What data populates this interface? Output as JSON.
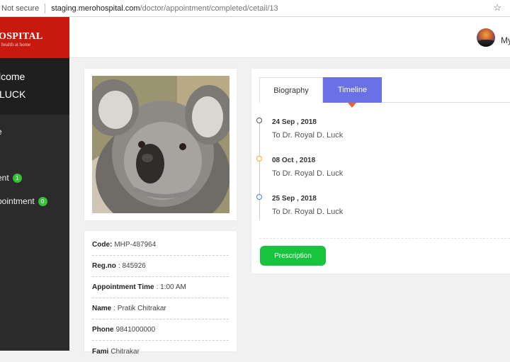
{
  "browser": {
    "security": "Not secure",
    "host": "staging.merohospital.com",
    "path": "/doctor/appointment/completed/cetail/13"
  },
  "sidebar": {
    "logo_title": "OSPITAL",
    "logo_tagline": "health at home",
    "welcome_line1": "lcome",
    "welcome_line2": "LUCK",
    "items": [
      {
        "label": "e"
      },
      {
        "label": "ent",
        "count": "1"
      },
      {
        "label": "pointment",
        "count": "0"
      }
    ]
  },
  "topbar": {
    "user": "My"
  },
  "profile": {
    "rows": [
      {
        "label": "Code:",
        "value": "MHP-487964"
      },
      {
        "label": "Reg.no",
        "value": ": 845926"
      },
      {
        "label": "Appointment Time",
        "value": ": 1:00 AM"
      },
      {
        "label": "Name",
        "value": ": Pratik Chitrakar"
      },
      {
        "label": "Phone",
        "value": "9841000000"
      },
      {
        "label": "Fami",
        "value": "Chitrakar"
      }
    ]
  },
  "timeline_panel": {
    "tabs": [
      {
        "label": "Biography"
      },
      {
        "label": "Timeline"
      }
    ],
    "entries": [
      {
        "date": "24 Sep , 2018",
        "text": "To Dr. Royal D. Luck",
        "color": "#555555"
      },
      {
        "date": "08 Oct , 2018",
        "text": "To Dr. Royal D. Luck",
        "color": "#e8b418"
      },
      {
        "date": "25 Sep , 2018",
        "text": "To Dr. Royal D. Luck",
        "color": "#3b87d6"
      }
    ],
    "prescription_label": "Prescription"
  },
  "colors": {
    "brand_red": "#c8190f",
    "tab_active": "#6a70e6",
    "button_green": "#18c33e"
  }
}
